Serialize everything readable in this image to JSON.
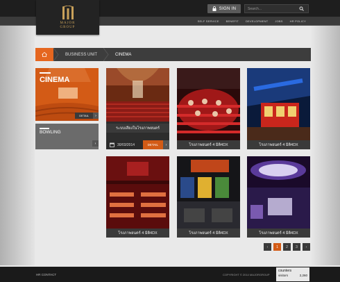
{
  "header": {
    "logo_text": "MAJOR\nGROUP",
    "signin_label": "SIGN IN",
    "search_placeholder": "Search..."
  },
  "menu": [
    "SELF SERVICE",
    "BENEFIT",
    "DEVELOPMENT",
    "JOBS",
    "HR POLICY"
  ],
  "breadcrumb": [
    "BUSINESS UNIT",
    "CINEMA"
  ],
  "categories": {
    "cinema": {
      "title": "CINEMA",
      "detail": "DETAIL"
    },
    "bowling": {
      "title": "BOWLING"
    }
  },
  "cards": [
    {
      "caption": "ระบบเสียงในโรงภาพยนตร์",
      "date": "30/03/2014",
      "detail": "DETAIL"
    },
    {
      "caption": "โรงภาพยนตร์ 4 มิติ4DX"
    },
    {
      "caption": "โรงภาพยนตร์ 4 มิติ4DX"
    },
    {
      "caption": "โรงภาพยนตร์ 4 มิติ4DX"
    },
    {
      "caption": "โรงภาพยนตร์ 4 มิติ4DX"
    },
    {
      "caption": "โรงภาพยนตร์ 4 มิติ4DX"
    }
  ],
  "pagination": {
    "prev": "‹",
    "pages": [
      "1",
      "2",
      "3"
    ],
    "next": "›",
    "current": "1"
  },
  "footer": {
    "contact": "HR CONTACT",
    "copyright": "COPYRIGHT © 2014 MAJORGROUP"
  },
  "counter": {
    "title": "counters",
    "visitors_label": "visitors",
    "visitors_value": "2,260"
  },
  "colors": {
    "accent": "#d35b16",
    "dark": "#1e1e1e",
    "caption_bg": "#3a3a3a"
  }
}
